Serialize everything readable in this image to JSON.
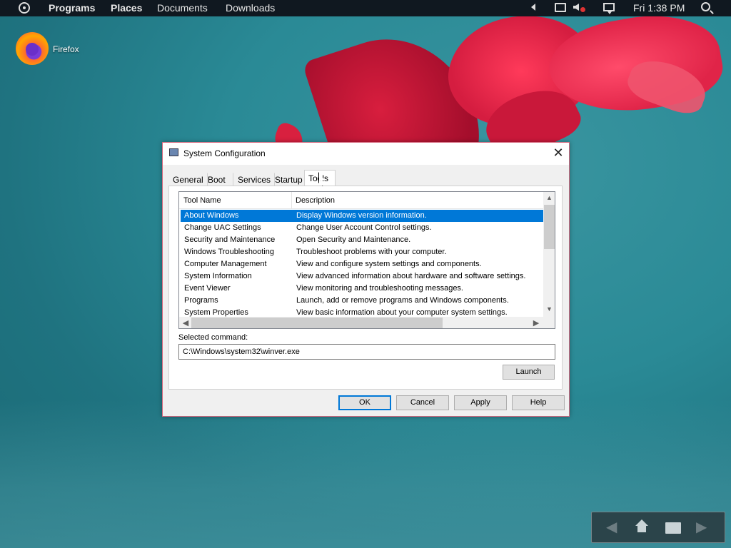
{
  "top_panel": {
    "menus": [
      "Programs",
      "Places",
      "Documents",
      "Downloads"
    ],
    "clock": "Fri 1:38 PM",
    "icons": [
      "circle-menu-icon",
      "left-arrow-icon",
      "network-icon",
      "volume-muted-icon",
      "notification-icon",
      "search-icon"
    ]
  },
  "desktop": {
    "icons": [
      {
        "label": "Firefox",
        "icon": "firefox-icon"
      }
    ]
  },
  "dialog": {
    "title": "System Configuration",
    "close": "✕",
    "tabs": [
      "General",
      "Boot",
      "Services",
      "Startup",
      "Tools"
    ],
    "active_tab": "Tools",
    "columns": [
      "Tool Name",
      "Description"
    ],
    "rows": [
      [
        "About Windows",
        "Display Windows version information."
      ],
      [
        "Change UAC Settings",
        "Change User Account Control settings."
      ],
      [
        "Security and Maintenance",
        "Open Security and Maintenance."
      ],
      [
        "Windows Troubleshooting",
        "Troubleshoot problems with your computer."
      ],
      [
        "Computer Management",
        "View and configure system settings and components."
      ],
      [
        "System Information",
        "View advanced information about hardware and software settings."
      ],
      [
        "Event Viewer",
        "View monitoring and troubleshooting messages."
      ],
      [
        "Programs",
        "Launch, add or remove programs and Windows components."
      ],
      [
        "System Properties",
        "View basic information about your computer system settings."
      ]
    ],
    "selected_row": 0,
    "selected_label": "Selected command:",
    "selected_command": "C:\\Windows\\system32\\winver.exe",
    "launch": "Launch",
    "ok": "OK",
    "cancel": "Cancel",
    "apply": "Apply",
    "help": "Help"
  },
  "dock": {
    "icons": [
      "back-arrow-icon",
      "home-icon",
      "folder-icon",
      "forward-arrow-icon"
    ]
  },
  "colors": {
    "selection": "#0078d7",
    "panel": "#101820",
    "wallpaper": "#2a8a96",
    "petal": "#d81e3e"
  }
}
